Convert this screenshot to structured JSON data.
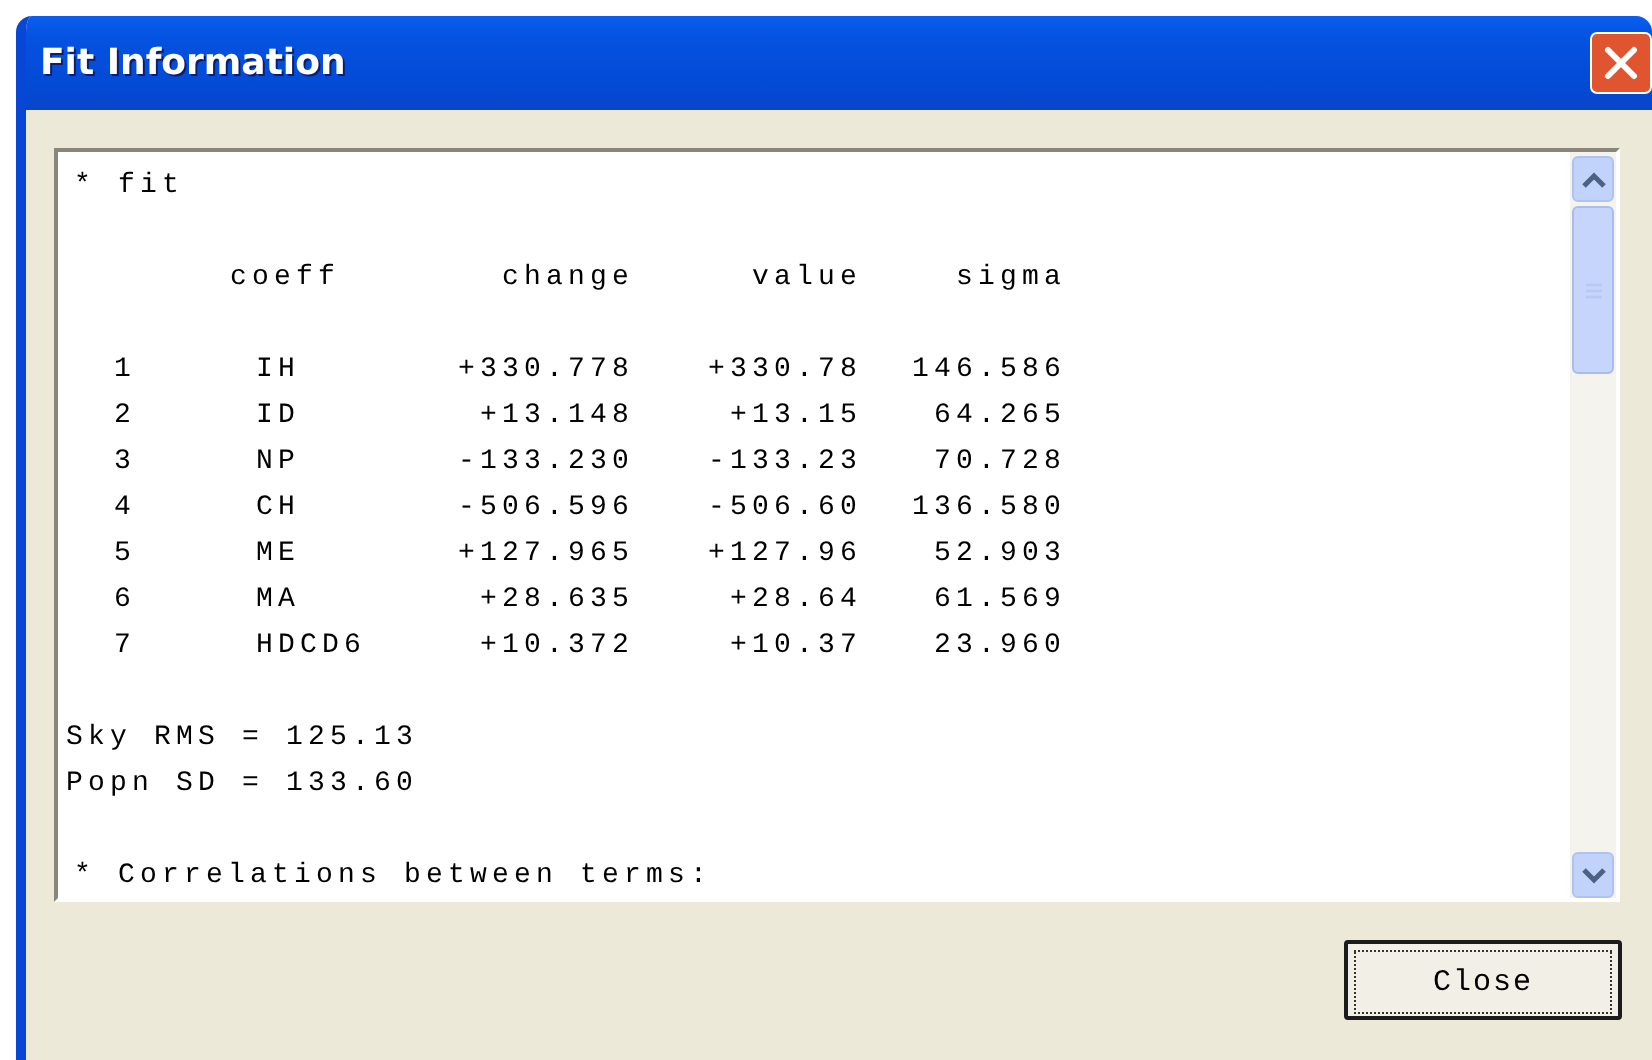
{
  "window": {
    "title": "Fit Information"
  },
  "output": {
    "heading": "* fit",
    "columns": [
      "coeff",
      "change",
      "value",
      "sigma"
    ],
    "rows": [
      {
        "index": "1",
        "coeff": "IH",
        "change": "+330.778",
        "value": "+330.78",
        "sigma": "146.586"
      },
      {
        "index": "2",
        "coeff": "ID",
        "change": "+13.148",
        "value": "+13.15",
        "sigma": "64.265"
      },
      {
        "index": "3",
        "coeff": "NP",
        "change": "-133.230",
        "value": "-133.23",
        "sigma": "70.728"
      },
      {
        "index": "4",
        "coeff": "CH",
        "change": "-506.596",
        "value": "-506.60",
        "sigma": "136.580"
      },
      {
        "index": "5",
        "coeff": "ME",
        "change": "+127.965",
        "value": "+127.96",
        "sigma": "52.903"
      },
      {
        "index": "6",
        "coeff": "MA",
        "change": "+28.635",
        "value": "+28.64",
        "sigma": "61.569"
      },
      {
        "index": "7",
        "coeff": "HDCD6",
        "change": "+10.372",
        "value": "+10.37",
        "sigma": "23.960"
      }
    ],
    "stats": [
      "Sky RMS = 125.13",
      "Popn SD = 133.60"
    ],
    "footer_line": "* Correlations between terms:"
  },
  "buttons": [
    {
      "label": "Close",
      "focused": true
    }
  ]
}
